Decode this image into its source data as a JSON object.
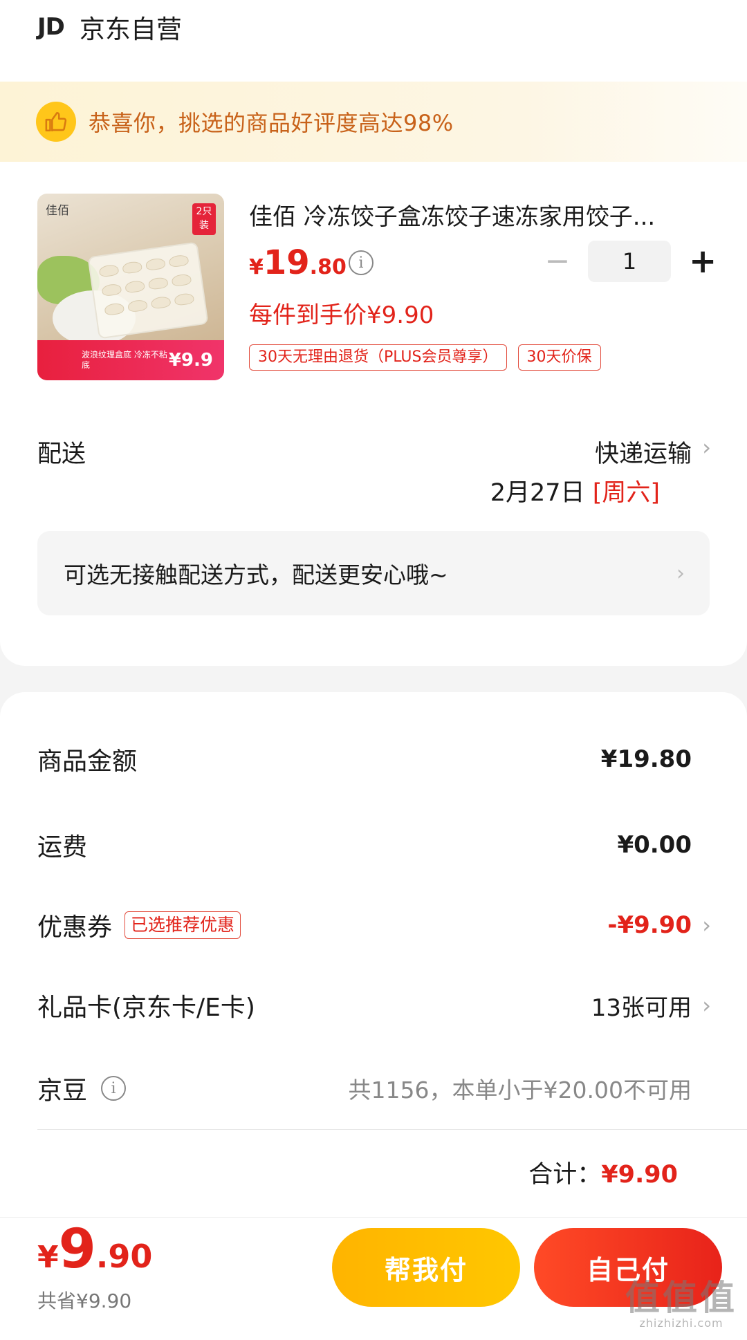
{
  "shop": {
    "logo": "JD",
    "name": "京东自营"
  },
  "banner": {
    "icon": "thumbs-up-icon",
    "text": "恭喜你，挑选的商品好评度高达98%"
  },
  "product": {
    "image": {
      "brand": "佳佰",
      "badge": "2只装",
      "bottom_text": "波浪纹理盒底 冷冻不粘底",
      "bottom_price": "¥9.9"
    },
    "title": "佳佰 冷冻饺子盒冻饺子速冻家用饺子...",
    "price_symbol": "¥",
    "price_int": "19",
    "price_dec": ".80",
    "quantity_minus": "−",
    "quantity": "1",
    "quantity_plus": "+",
    "unit_price_text": "每件到手价¥9.90",
    "tags": [
      "30天无理由退货（PLUS会员尊享）",
      "30天价保"
    ]
  },
  "delivery": {
    "label": "配送",
    "method": "快递运输",
    "date": "2月27日",
    "weekday": "[周六]",
    "contactless": "可选无接触配送方式，配送更安心哦~"
  },
  "summary": {
    "goods_label": "商品金额",
    "goods_value": "¥19.80",
    "shipping_label": "运费",
    "shipping_value": "¥0.00",
    "coupon_label": "优惠券",
    "coupon_tag": "已选推荐优惠",
    "coupon_value": "-¥9.90",
    "giftcard_label": "礼品卡(京东卡/E卡)",
    "giftcard_value": "13张可用",
    "bean_label": "京豆",
    "bean_value": "共1156，本单小于¥20.00不可用",
    "total_label": "合计：",
    "total_value": "¥9.90"
  },
  "footer": {
    "price_symbol": "¥",
    "price_int": "9",
    "price_dec": ".90",
    "saved": "共省¥9.90",
    "help_pay": "帮我付",
    "self_pay": "自己付"
  },
  "watermark": {
    "big": "值值值",
    "small": "zhizhizhi.com"
  },
  "colors": {
    "accent": "#e2231a",
    "yellow": "#ffc700",
    "banner_text": "#c8621a"
  }
}
